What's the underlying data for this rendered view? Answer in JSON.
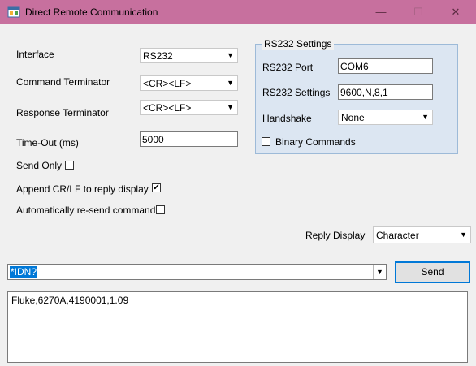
{
  "window": {
    "title": "Direct Remote Communication",
    "minimize_glyph": "—",
    "maximize_glyph": "☐",
    "close_glyph": "✕"
  },
  "form": {
    "interface_label": "Interface",
    "interface_value": "RS232",
    "command_terminator_label": "Command Terminator",
    "command_terminator_value": "<CR><LF>",
    "response_terminator_label": "Response Terminator",
    "response_terminator_value": "<CR><LF>",
    "timeout_label": "Time-Out (ms)",
    "timeout_value": "5000",
    "send_only_label": "Send Only",
    "send_only_checked": false,
    "append_crlf_label": "Append CR/LF to reply display",
    "append_crlf_checked": true,
    "auto_resend_label": "Automatically re-send command",
    "auto_resend_checked": false,
    "reply_display_label": "Reply Display",
    "reply_display_value": "Character"
  },
  "rs232": {
    "group_title": "RS232 Settings",
    "port_label": "RS232 Port",
    "port_value": "COM6",
    "settings_label": "RS232 Settings",
    "settings_value": "9600,N,8,1",
    "handshake_label": "Handshake",
    "handshake_value": "None",
    "binary_label": "Binary Commands",
    "binary_checked": false
  },
  "command": {
    "value": "*IDN?",
    "send_label": "Send"
  },
  "reply": {
    "text": "Fluke,6270A,4190001,1.09"
  },
  "icons": {
    "app": "app-window-icon",
    "dropdown": "chevron-down-icon",
    "check": "checkmark-icon"
  }
}
